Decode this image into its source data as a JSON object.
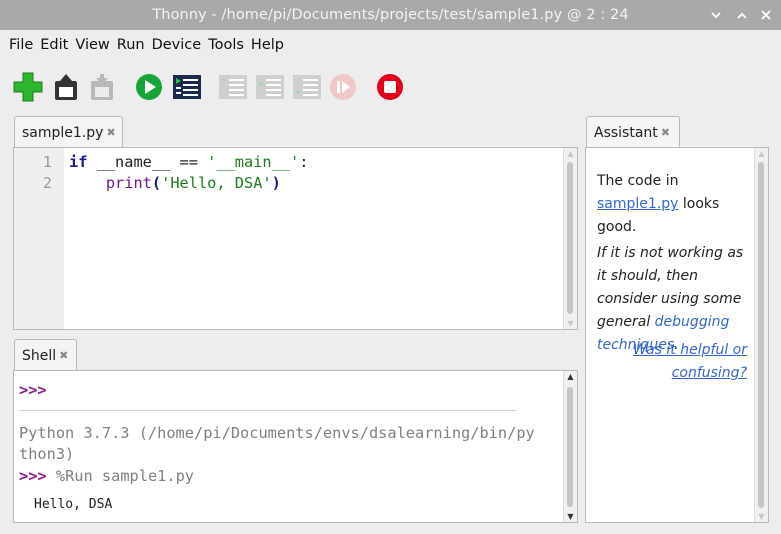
{
  "window": {
    "title": "Thonny  -  /home/pi/Documents/projects/test/sample1.py  @  2 : 24",
    "colors": {
      "titlebar": "#a9a9a9",
      "run": "#17a53a",
      "stop": "#e2001a"
    }
  },
  "menu": [
    "File",
    "Edit",
    "View",
    "Run",
    "Device",
    "Tools",
    "Help"
  ],
  "toolbar": {
    "icons": [
      "new-file-icon",
      "open-file-icon",
      "save-file-icon",
      "run-icon",
      "debug-icon",
      "step-over-icon",
      "step-into-icon",
      "step-out-icon",
      "resume-icon",
      "stop-icon"
    ]
  },
  "editor": {
    "tab_label": "sample1.py",
    "line_numbers": [
      "1",
      "2"
    ],
    "lines": [
      [
        "if",
        " __name__ == ",
        "'__main__'",
        ":"
      ],
      [
        "    ",
        "print",
        "(",
        "'Hello, DSA'",
        ")"
      ]
    ]
  },
  "shell": {
    "tab_label": "Shell",
    "prompt": ">>>",
    "separator": "______________________________________________________",
    "python_info": [
      "Python 3.7.3 (/home/pi/Documents/envs/dsalearning/bin/py",
      "thon3)"
    ],
    "run_command": "%Run sample1.py",
    "output": "Hello, DSA"
  },
  "assistant": {
    "tab_label": "Assistant",
    "text_1": "The code in",
    "file_link": "sample1.py",
    "text_2": "looks good.",
    "text_3": "If it is not working as it should, then consider using some general",
    "debug_link": "debugging techniques",
    "text_4": ".",
    "feedback_link": "Was it helpful or confusing?"
  }
}
